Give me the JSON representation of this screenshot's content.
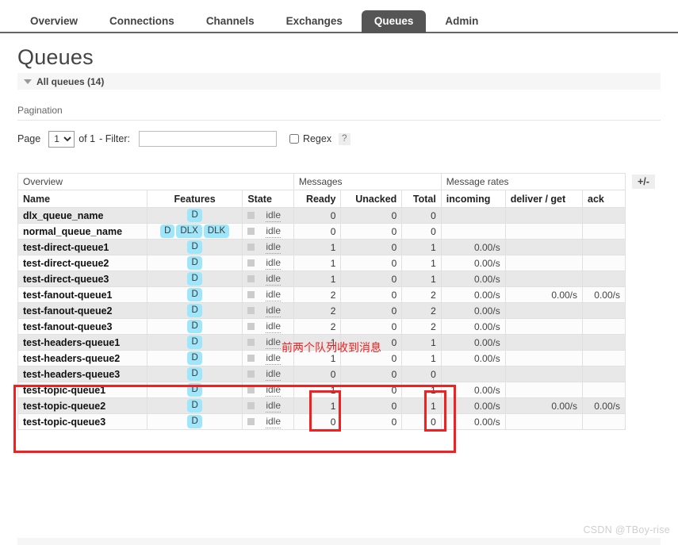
{
  "nav": {
    "tabs": [
      {
        "label": "Overview",
        "active": false
      },
      {
        "label": "Connections",
        "active": false
      },
      {
        "label": "Channels",
        "active": false
      },
      {
        "label": "Exchanges",
        "active": false
      },
      {
        "label": "Queues",
        "active": true
      },
      {
        "label": "Admin",
        "active": false
      }
    ]
  },
  "page": {
    "title": "Queues",
    "section_label": "All queues (14)"
  },
  "pagination": {
    "label": "Pagination",
    "page_word": "Page",
    "page_value": "1",
    "page_options": [
      "1"
    ],
    "of_text": "of 1",
    "filter_label": "- Filter:",
    "filter_value": "",
    "regex_label": "Regex",
    "help": "?"
  },
  "table": {
    "plusminus": "+/-",
    "group_headers": [
      {
        "label": "Overview",
        "span": 3
      },
      {
        "label": "Messages",
        "span": 3
      },
      {
        "label": "Message rates",
        "span": 3
      }
    ],
    "columns": [
      "Name",
      "Features",
      "State",
      "Ready",
      "Unacked",
      "Total",
      "incoming",
      "deliver / get",
      "ack"
    ],
    "rows": [
      {
        "name": "dlx_queue_name",
        "features": [
          "D"
        ],
        "state": "idle",
        "ready": "0",
        "unacked": "0",
        "total": "0",
        "incoming": "",
        "deliver": "",
        "ack": ""
      },
      {
        "name": "normal_queue_name",
        "features": [
          "D",
          "DLX",
          "DLK"
        ],
        "state": "idle",
        "ready": "0",
        "unacked": "0",
        "total": "0",
        "incoming": "",
        "deliver": "",
        "ack": ""
      },
      {
        "name": "test-direct-queue1",
        "features": [
          "D"
        ],
        "state": "idle",
        "ready": "1",
        "unacked": "0",
        "total": "1",
        "incoming": "0.00/s",
        "deliver": "",
        "ack": ""
      },
      {
        "name": "test-direct-queue2",
        "features": [
          "D"
        ],
        "state": "idle",
        "ready": "1",
        "unacked": "0",
        "total": "1",
        "incoming": "0.00/s",
        "deliver": "",
        "ack": ""
      },
      {
        "name": "test-direct-queue3",
        "features": [
          "D"
        ],
        "state": "idle",
        "ready": "1",
        "unacked": "0",
        "total": "1",
        "incoming": "0.00/s",
        "deliver": "",
        "ack": ""
      },
      {
        "name": "test-fanout-queue1",
        "features": [
          "D"
        ],
        "state": "idle",
        "ready": "2",
        "unacked": "0",
        "total": "2",
        "incoming": "0.00/s",
        "deliver": "0.00/s",
        "ack": "0.00/s"
      },
      {
        "name": "test-fanout-queue2",
        "features": [
          "D"
        ],
        "state": "idle",
        "ready": "2",
        "unacked": "0",
        "total": "2",
        "incoming": "0.00/s",
        "deliver": "",
        "ack": ""
      },
      {
        "name": "test-fanout-queue3",
        "features": [
          "D"
        ],
        "state": "idle",
        "ready": "2",
        "unacked": "0",
        "total": "2",
        "incoming": "0.00/s",
        "deliver": "",
        "ack": ""
      },
      {
        "name": "test-headers-queue1",
        "features": [
          "D"
        ],
        "state": "idle",
        "ready": "1",
        "unacked": "0",
        "total": "1",
        "incoming": "0.00/s",
        "deliver": "",
        "ack": ""
      },
      {
        "name": "test-headers-queue2",
        "features": [
          "D"
        ],
        "state": "idle",
        "ready": "1",
        "unacked": "0",
        "total": "1",
        "incoming": "0.00/s",
        "deliver": "",
        "ack": ""
      },
      {
        "name": "test-headers-queue3",
        "features": [
          "D"
        ],
        "state": "idle",
        "ready": "0",
        "unacked": "0",
        "total": "0",
        "incoming": "",
        "deliver": "",
        "ack": ""
      },
      {
        "name": "test-topic-queue1",
        "features": [
          "D"
        ],
        "state": "idle",
        "ready": "1",
        "unacked": "0",
        "total": "1",
        "incoming": "0.00/s",
        "deliver": "",
        "ack": ""
      },
      {
        "name": "test-topic-queue2",
        "features": [
          "D"
        ],
        "state": "idle",
        "ready": "1",
        "unacked": "0",
        "total": "1",
        "incoming": "0.00/s",
        "deliver": "0.00/s",
        "ack": "0.00/s"
      },
      {
        "name": "test-topic-queue3",
        "features": [
          "D"
        ],
        "state": "idle",
        "ready": "0",
        "unacked": "0",
        "total": "0",
        "incoming": "0.00/s",
        "deliver": "",
        "ack": ""
      }
    ]
  },
  "annotations": {
    "color": "#f22020",
    "note_text": "前两个队列收到消息"
  },
  "watermark": {
    "text": "CSDN @TBoy-rise"
  }
}
